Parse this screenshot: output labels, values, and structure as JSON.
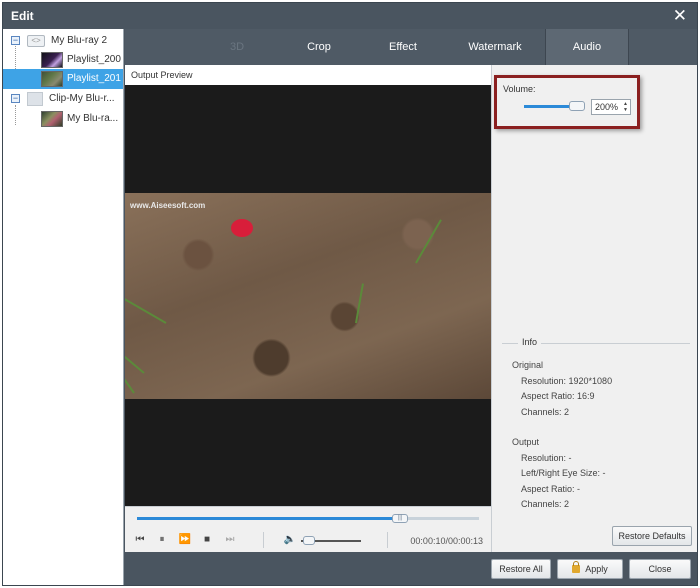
{
  "window": {
    "title": "Edit"
  },
  "sidebar": {
    "items": [
      {
        "label": "My Blu-ray 2"
      },
      {
        "label": "Playlist_200"
      },
      {
        "label": "Playlist_201"
      },
      {
        "label": "Clip-My Blu-r..."
      },
      {
        "label": "My Blu-ra..."
      }
    ]
  },
  "tabs": [
    {
      "label": "3D"
    },
    {
      "label": "Crop"
    },
    {
      "label": "Effect"
    },
    {
      "label": "Watermark"
    },
    {
      "label": "Audio"
    }
  ],
  "preview": {
    "header": "Output Preview",
    "watermark": "www.Aiseesoft.com",
    "progress_fraction": 0.77,
    "time": "00:00:10/00:00:13"
  },
  "audio": {
    "volume_label": "Volume:",
    "volume_value": "200%",
    "volume_slider_fraction": 1.0
  },
  "info": {
    "legend": "Info",
    "original_heading": "Original",
    "original": {
      "resolution": "Resolution: 1920*1080",
      "aspect_ratio": "Aspect Ratio: 16:9",
      "channels": "Channels: 2"
    },
    "output_heading": "Output",
    "output": {
      "resolution": "Resolution: -",
      "eye_size": "Left/Right Eye Size: -",
      "aspect_ratio": "Aspect Ratio: -",
      "channels": "Channels: 2"
    }
  },
  "buttons": {
    "restore_defaults": "Restore Defaults",
    "restore_all": "Restore All",
    "apply": "Apply",
    "close": "Close"
  },
  "colors": {
    "accent": "#2c8ad8",
    "selected_row": "#3ea3e6",
    "highlight_box": "#8b2020"
  }
}
